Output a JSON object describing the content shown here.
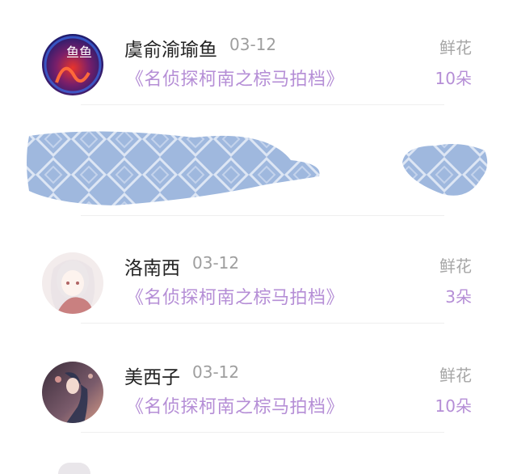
{
  "items": [
    {
      "name": "虞俞渝瑜鱼",
      "date": "03-12",
      "book": "《名侦探柯南之棕马拍档》",
      "gift_label": "鲜花",
      "count": "10朵",
      "avatar_text": "鱼鱼"
    },
    {
      "name": "洛南西",
      "date": "03-12",
      "book": "《名侦探柯南之棕马拍档》",
      "gift_label": "鲜花",
      "count": "3朵"
    },
    {
      "name": "美西子",
      "date": "03-12",
      "book": "《名侦探柯南之棕马拍档》",
      "gift_label": "鲜花",
      "count": "10朵"
    }
  ],
  "colors": {
    "accent": "#b58ed6",
    "muted": "#a6a6a6",
    "redaction": "#9fb8de"
  }
}
